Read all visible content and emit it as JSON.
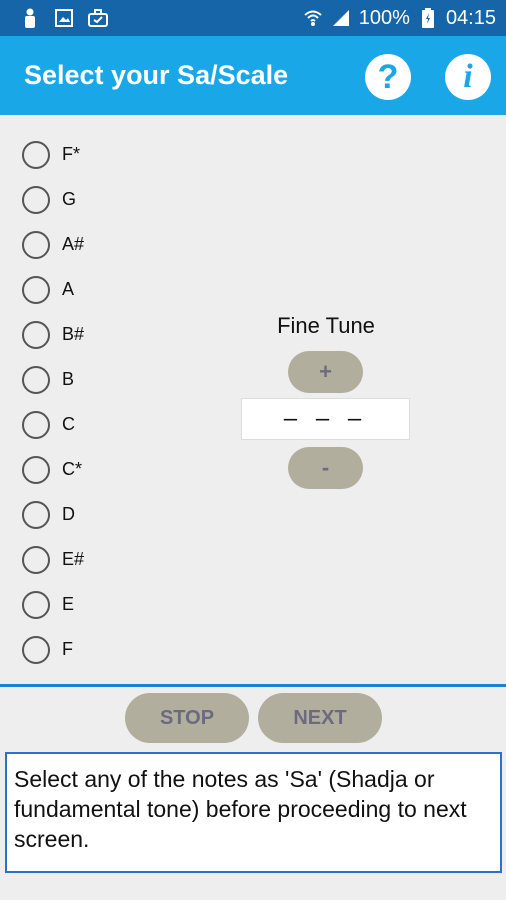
{
  "status_bar": {
    "icons": [
      "person-icon",
      "image-icon",
      "briefcase-icon",
      "wifi-icon",
      "signal-icon",
      "battery-icon"
    ],
    "battery": "100%",
    "time": "04:15"
  },
  "app_bar": {
    "title": "Select your Sa/Scale",
    "help_label": "?",
    "info_label": "i"
  },
  "scales": [
    {
      "label": "F*"
    },
    {
      "label": "G"
    },
    {
      "label": "A#"
    },
    {
      "label": "A"
    },
    {
      "label": "B#"
    },
    {
      "label": "B"
    },
    {
      "label": "C"
    },
    {
      "label": "C*"
    },
    {
      "label": "D"
    },
    {
      "label": "E#"
    },
    {
      "label": "E"
    },
    {
      "label": "F"
    }
  ],
  "fine_tune": {
    "title": "Fine Tune",
    "plus_label": "+",
    "minus_label": "-",
    "value": "– – –"
  },
  "controls": {
    "stop_label": "STOP",
    "next_label": "NEXT"
  },
  "message": "Select any of the notes as 'Sa' (Shadja or fundamental tone) before proceeding to next screen.",
  "colors": {
    "status_bar": "#1565a8",
    "app_bar": "#1aa7e8",
    "button": "#b1ae9e",
    "button_text": "#6d6a80",
    "accent_border": "#2b6fd1"
  }
}
